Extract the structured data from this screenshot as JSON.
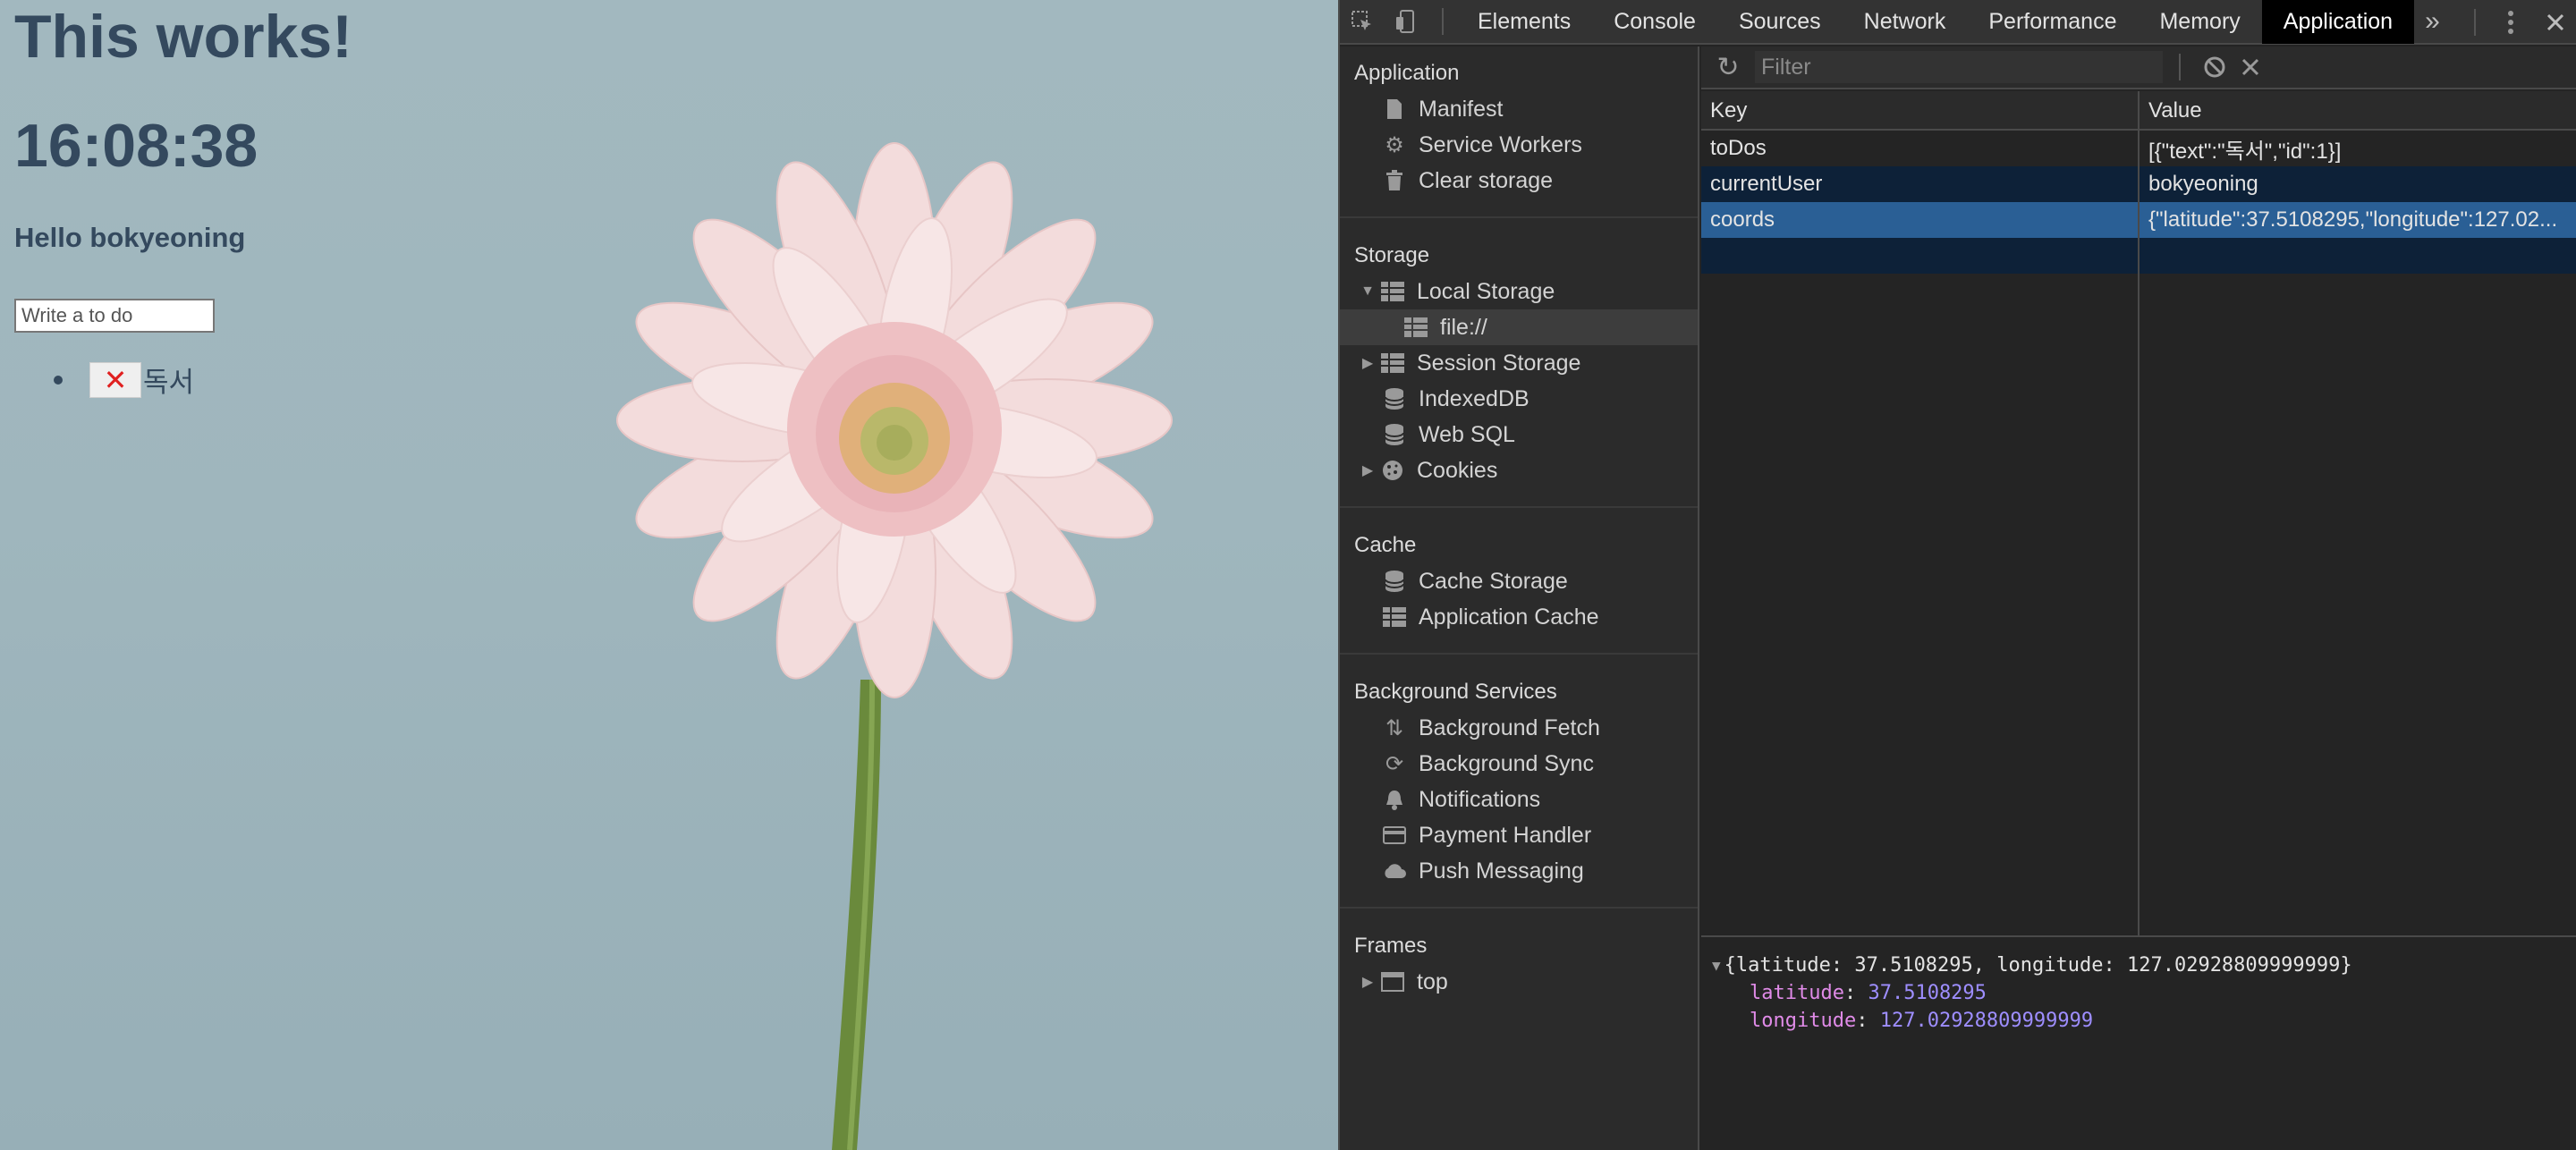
{
  "page": {
    "heading": "This works!",
    "clock": "16:08:38",
    "greeting": "Hello bokyeoning",
    "todo_placeholder": "Write a to do",
    "todos": [
      {
        "delete_label": "✕",
        "text": "독서"
      }
    ]
  },
  "devtools": {
    "tabs": [
      "Elements",
      "Console",
      "Sources",
      "Network",
      "Performance",
      "Memory",
      "Application"
    ],
    "active_tab": "Application",
    "more_tabs_label": "»",
    "sidebar": {
      "application": {
        "title": "Application",
        "items": [
          {
            "label": "Manifest",
            "icon": "file-icon"
          },
          {
            "label": "Service Workers",
            "icon": "gear-icon"
          },
          {
            "label": "Clear storage",
            "icon": "trash-icon"
          }
        ]
      },
      "storage": {
        "title": "Storage",
        "items": [
          {
            "label": "Local Storage",
            "icon": "grid-icon",
            "expanded": true
          },
          {
            "label": "file://",
            "icon": "grid-icon",
            "selected": true
          },
          {
            "label": "Session Storage",
            "icon": "grid-icon"
          },
          {
            "label": "IndexedDB",
            "icon": "database-icon"
          },
          {
            "label": "Web SQL",
            "icon": "database-icon"
          },
          {
            "label": "Cookies",
            "icon": "cookie-icon"
          }
        ]
      },
      "cache": {
        "title": "Cache",
        "items": [
          {
            "label": "Cache Storage",
            "icon": "database-icon"
          },
          {
            "label": "Application Cache",
            "icon": "grid-icon"
          }
        ]
      },
      "background": {
        "title": "Background Services",
        "items": [
          {
            "label": "Background Fetch",
            "icon": "updown-arrows-icon"
          },
          {
            "label": "Background Sync",
            "icon": "sync-icon"
          },
          {
            "label": "Notifications",
            "icon": "bell-icon"
          },
          {
            "label": "Payment Handler",
            "icon": "card-icon"
          },
          {
            "label": "Push Messaging",
            "icon": "cloud-icon"
          }
        ]
      },
      "frames": {
        "title": "Frames",
        "items": [
          {
            "label": "top",
            "icon": "frame-icon"
          }
        ]
      }
    },
    "filter_placeholder": "Filter",
    "table": {
      "headers": {
        "key": "Key",
        "value": "Value"
      },
      "rows": [
        {
          "key": "toDos",
          "value": "[{\"text\":\"독서\",\"id\":1}]"
        },
        {
          "key": "currentUser",
          "value": "bokyeoning"
        },
        {
          "key": "coords",
          "value": "{\"latitude\":37.5108295,\"longitude\":127.02..."
        }
      ]
    },
    "preview": {
      "summary": "{latitude: 37.5108295, longitude: 127.02928809999999}",
      "latitude_key": "latitude",
      "latitude_value": "37.5108295",
      "longitude_key": "longitude",
      "longitude_value": "127.02928809999999"
    }
  }
}
